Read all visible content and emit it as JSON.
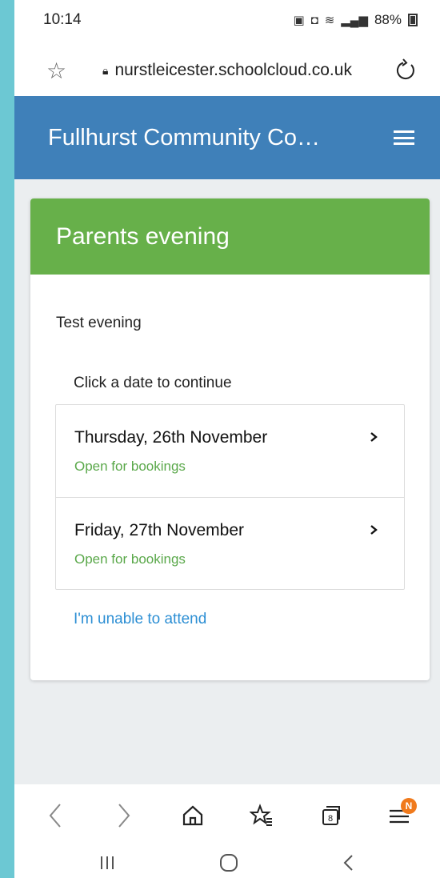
{
  "status_bar": {
    "time": "10:14",
    "icons": [
      "nfc-icon",
      "alarm-icon",
      "wifi-icon",
      "signal-icon"
    ],
    "battery": "88%"
  },
  "browser": {
    "url": "nurstleicester.schoolcloud.co.uk",
    "tab_count": "8",
    "menu_badge": "N"
  },
  "app": {
    "title": "Fullhurst Community Co…"
  },
  "card": {
    "header": "Parents evening",
    "event_name": "Test evening",
    "prompt": "Click a date to continue",
    "dates": [
      {
        "label": "Thursday, 26th November",
        "status": "Open for bookings"
      },
      {
        "label": "Friday, 27th November",
        "status": "Open for bookings"
      }
    ],
    "unable_link": "I'm unable to attend"
  },
  "colors": {
    "header_blue": "#3f80b9",
    "card_green": "#67b04a",
    "status_green": "#5aa84a",
    "link_blue": "#2d8fd4",
    "badge_orange": "#f07a1c"
  }
}
